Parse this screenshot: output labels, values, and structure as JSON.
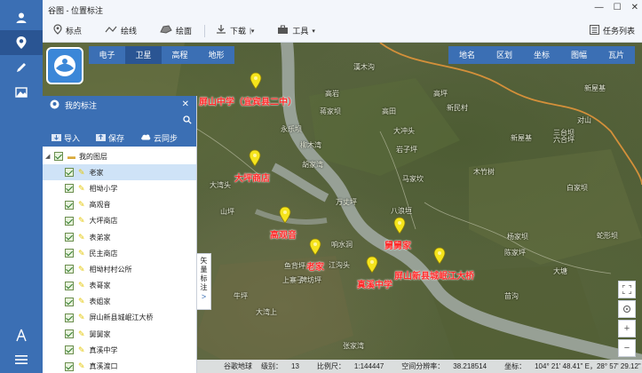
{
  "window": {
    "title": "谷图 - 位置标注"
  },
  "toolbar": {
    "items": [
      {
        "label": "标点",
        "icon": "location-pin-icon"
      },
      {
        "label": "绘线",
        "icon": "polyline-icon"
      },
      {
        "label": "绘面",
        "icon": "polygon-icon"
      },
      {
        "label": "下载",
        "icon": "download-icon"
      },
      {
        "label": "工具",
        "icon": "toolbox-icon"
      }
    ],
    "task_list": "任务列表"
  },
  "map_types": [
    "电子",
    "卫星",
    "高程",
    "地形"
  ],
  "map_type_selected": "卫星",
  "map_tools": [
    "地名",
    "区划",
    "坐标",
    "图幅",
    "瓦片"
  ],
  "panel": {
    "title": "我的标注",
    "actions": [
      "导入",
      "保存",
      "云同步"
    ],
    "root_layer": "我的图层",
    "items": [
      "老家",
      "相坳小学",
      "高观音",
      "大坪商店",
      "表弟家",
      "民主商店",
      "相坳村村公所",
      "表哥家",
      "表姐家",
      "屏山新县城岷江大桥",
      "舅舅家",
      "真溪中学",
      "真溪渡口"
    ],
    "selected_index": 0
  },
  "vector_tab": [
    "矢",
    "量",
    "标",
    "注"
  ],
  "map_labels": {
    "places": [
      "漢木沟",
      "高岩",
      "蒋家坝",
      "永乐坝",
      "柳木湾",
      "胡家湾",
      "高田",
      "高坪",
      "新民村",
      "新屋基",
      "对山",
      "岩子坪",
      "马家坎",
      "木竹树",
      "大冲头",
      "六合坪",
      "新屋基",
      "三台坝",
      "白家坝",
      "大湾头",
      "八浪垣",
      "万丈坪",
      "山坪",
      "响水洞",
      "江沟头",
      "鱼背坪",
      "上寨子",
      "牌坊坪",
      "牛坪",
      "大湾上",
      "杨家坝",
      "陈家坪",
      "大塘",
      "蛇形坝",
      "苗沟",
      "张家湾"
    ],
    "marks": [
      "屏山中学（宜宾县二中）",
      "大坪商店",
      "高观音",
      "老家",
      "舅舅家",
      "真溪中学",
      "屏山新县城岷江大桥"
    ]
  },
  "status": {
    "source": "谷歌地球",
    "zoom_label": "级别：",
    "zoom_value": "13",
    "scale_label": "比例尺：",
    "scale_value": "1:144447",
    "resolution_label": "空间分辨率：",
    "resolution_value": "38.218514",
    "coord_label": "坐标：",
    "coord_value": "104° 21' 48.41\" E，28° 57' 29.12\" N"
  }
}
